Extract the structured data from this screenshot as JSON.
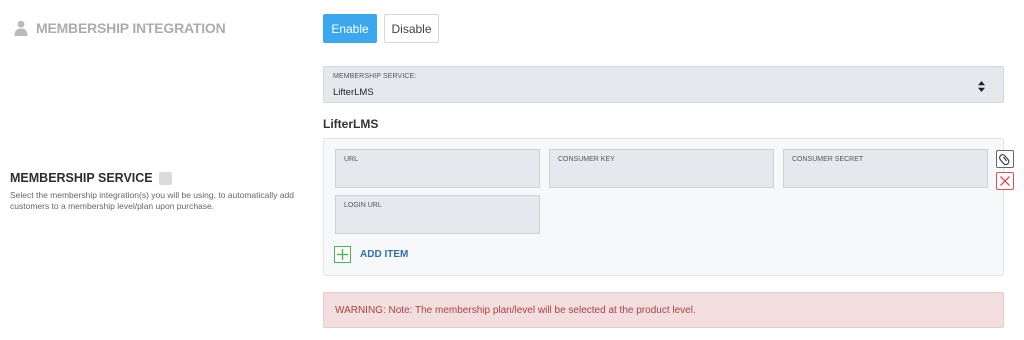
{
  "header": {
    "title": "MEMBERSHIP INTEGRATION",
    "icon": "user-icon"
  },
  "toggle": {
    "enable_label": "Enable",
    "disable_label": "Disable",
    "active": "Enable",
    "accent": "#3ba7ef"
  },
  "membership_select": {
    "label": "MEMBERSHIP SERVICE:",
    "value": "LifterLMS"
  },
  "section": {
    "title": "LifterLMS"
  },
  "description": {
    "title": "MEMBERSHIP SERVICE",
    "text": "Select the membership integration(s) you will be using, to automatically add customers to a membership level/plan upon purchase."
  },
  "repeater": {
    "fields": {
      "url": "URL",
      "consumer_key": "CONSUMER KEY",
      "consumer_secret": "CONSUMER SECRET",
      "login_url": "LOGIN URL"
    },
    "add_item_label": "ADD ITEM"
  },
  "warning": {
    "text": "WARNING: Note: The membership plan/level will be selected at the product level."
  }
}
